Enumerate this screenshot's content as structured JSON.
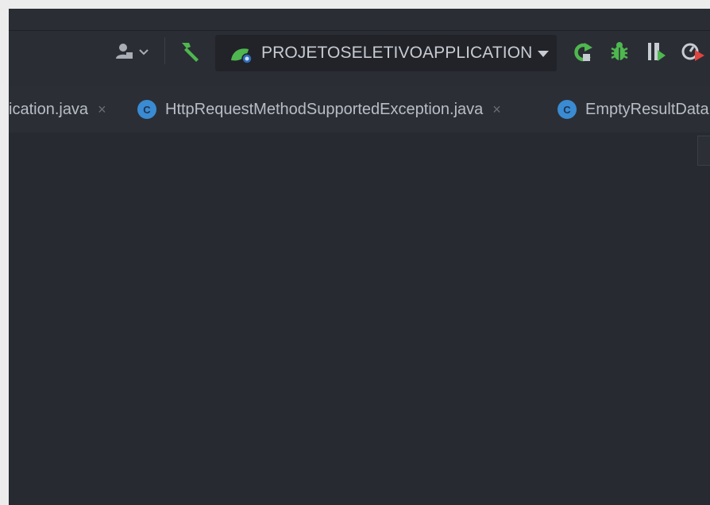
{
  "toolbar": {
    "icons": {
      "user": "user-icon",
      "dropdown": "chevron-down-icon",
      "build": "hammer-icon",
      "run_config_icon": "spring-boot-icon",
      "run_config_dropdown": "triangle-down-icon",
      "rerun": "rerun-icon",
      "debug": "bug-icon",
      "coverage": "coverage-icon",
      "profile": "profile-icon"
    },
    "run_config_label": "PROJETOSELETIVOAPPLICATION",
    "colors": {
      "green": "#4fb74f",
      "run_config_bg": "#212328"
    }
  },
  "tabs": [
    {
      "label": "ication.java",
      "close": "×",
      "badge": ""
    },
    {
      "label": "HttpRequestMethodSupportedException.java",
      "close": "×",
      "badge": "C"
    },
    {
      "label": "EmptyResultData",
      "close": "",
      "badge": "C"
    }
  ],
  "theme": {
    "editor_bg": "#272a31",
    "tab_badge_color": "#3a8bd1"
  }
}
